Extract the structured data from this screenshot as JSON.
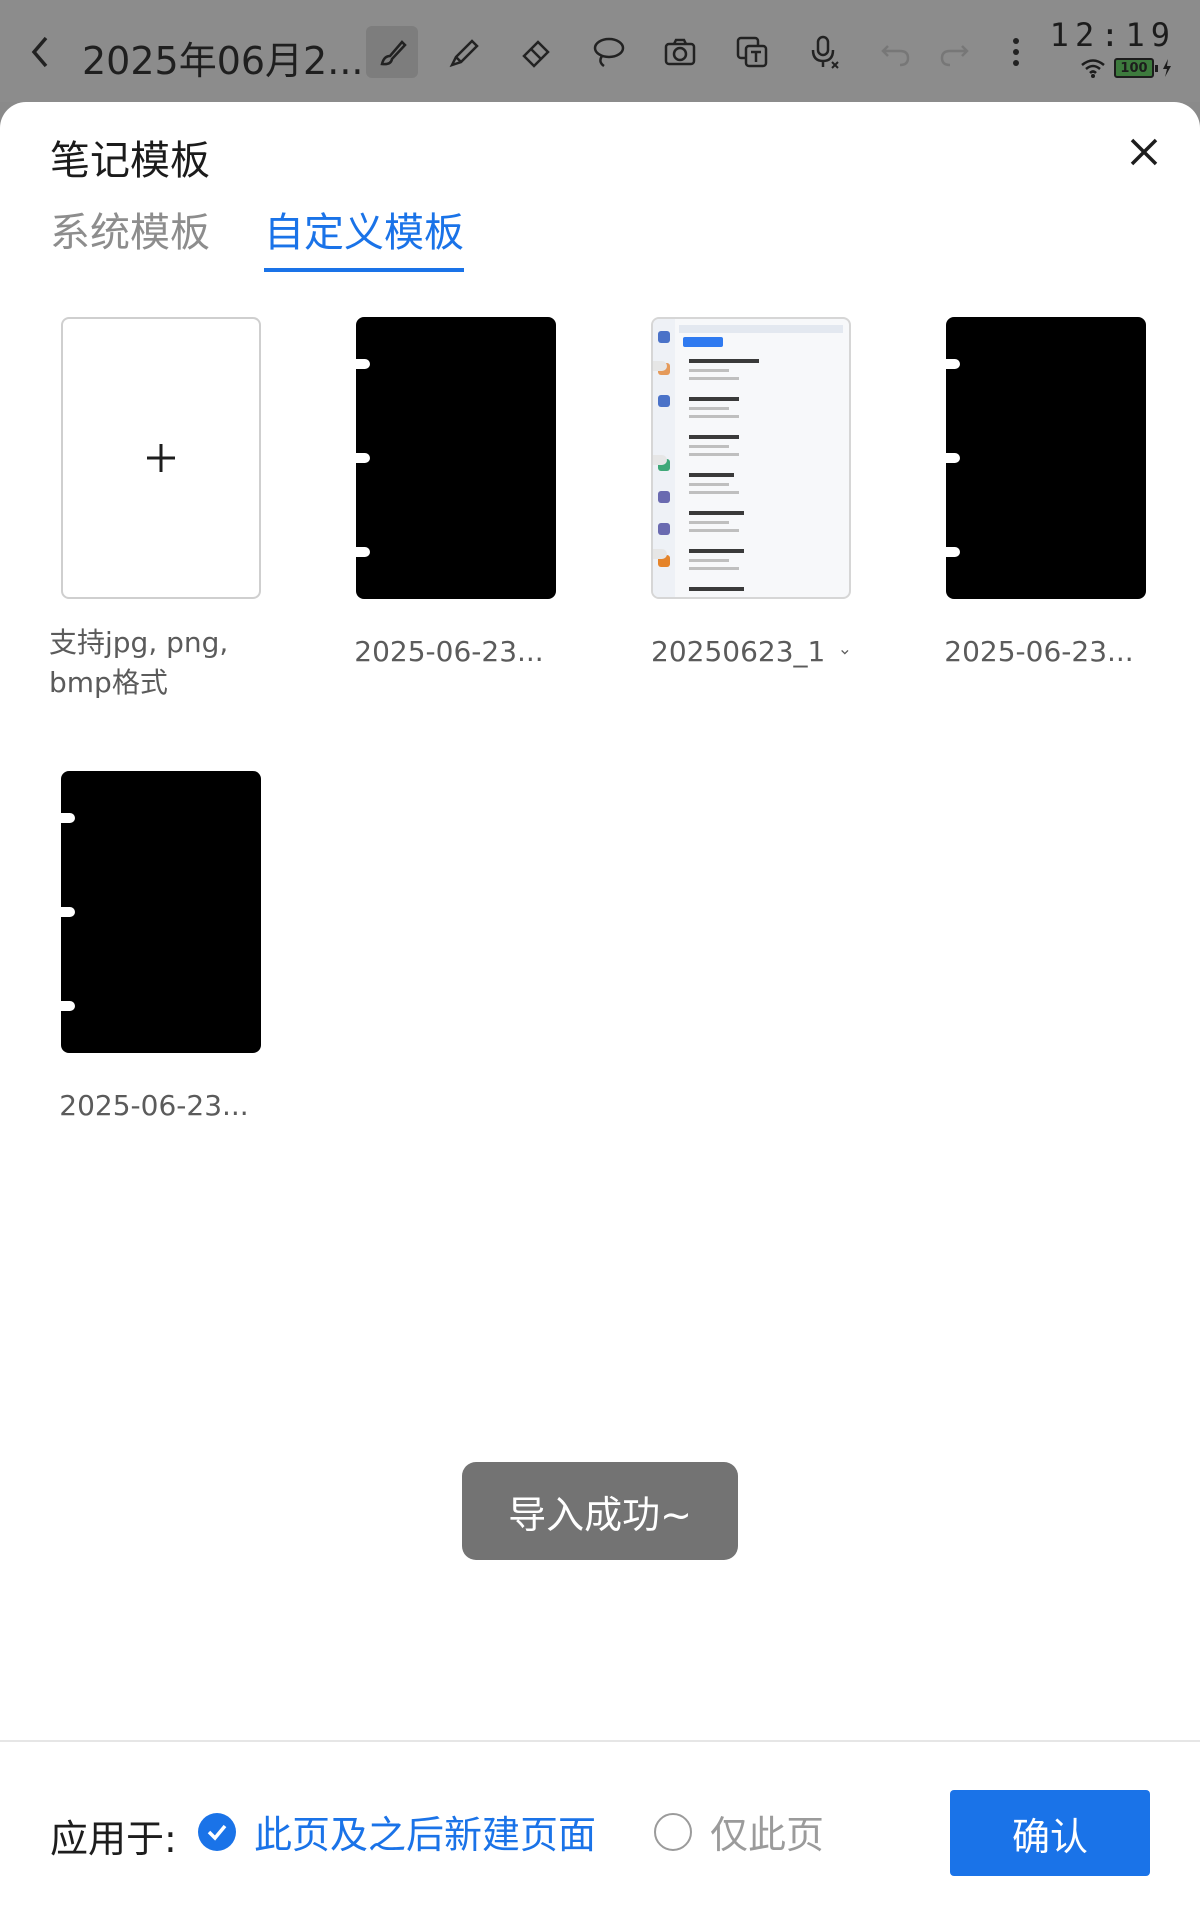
{
  "toolbar": {
    "title": "2025年06月2...",
    "tools": [
      "brush-icon",
      "highlighter-icon",
      "eraser-icon",
      "lasso-icon",
      "camera-icon",
      "text-recognize-icon",
      "voice-icon",
      "undo-icon",
      "redo-icon",
      "more-icon"
    ]
  },
  "status": {
    "time": "12:19",
    "battery": "100"
  },
  "dialog": {
    "title": "笔记模板",
    "tabs": [
      {
        "label": "系统模板",
        "active": false
      },
      {
        "label": "自定义模板",
        "active": true
      }
    ],
    "add_hint": "支持jpg, png, bmp格式",
    "templates": [
      {
        "label": "2025-06-23..."
      },
      {
        "label": "20250623_1"
      },
      {
        "label": "2025-06-23..."
      },
      {
        "label": "2025-06-23..."
      }
    ],
    "toast": "导入成功~"
  },
  "footer": {
    "apply_label": "应用于:",
    "option_selected": "此页及之后新建页面",
    "option_unselected": "仅此页",
    "confirm_label": "确认"
  }
}
